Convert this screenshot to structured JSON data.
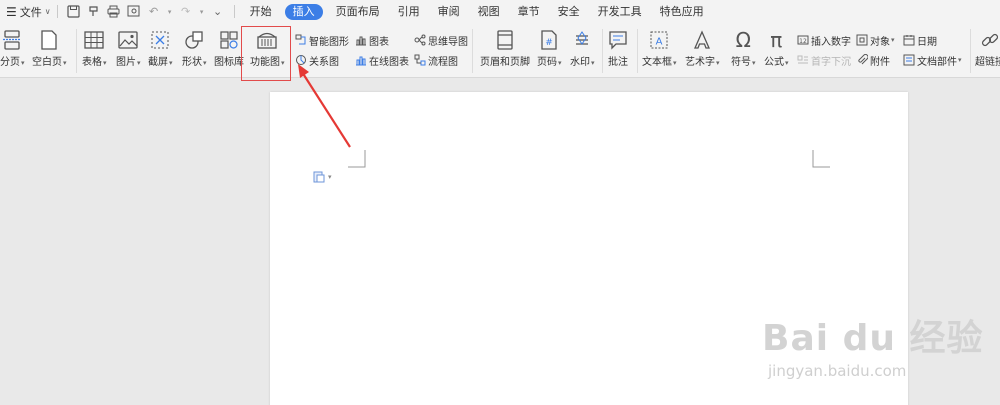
{
  "menubar": {
    "file_label": "文件",
    "tabs": [
      {
        "label": "开始"
      },
      {
        "label": "插入"
      },
      {
        "label": "页面布局"
      },
      {
        "label": "引用"
      },
      {
        "label": "审阅"
      },
      {
        "label": "视图"
      },
      {
        "label": "章节"
      },
      {
        "label": "安全"
      },
      {
        "label": "开发工具"
      },
      {
        "label": "特色应用"
      }
    ],
    "active_tab": "插入",
    "accent_color": "#3c7ee6"
  },
  "ribbon": {
    "page_break": "分页",
    "blank_page": "空白页",
    "table": "表格",
    "picture": "图片",
    "screenshot": "截屏",
    "shapes": "形状",
    "icon_library": "图标库",
    "function_chart": "功能图",
    "smart_art": "智能图形",
    "relation_chart": "关系图",
    "chart": "图表",
    "online_chart": "在线图表",
    "mind_map": "思维导图",
    "flowchart": "流程图",
    "header_footer": "页眉和页脚",
    "page_number": "页码",
    "watermark": "水印",
    "comment": "批注",
    "text_box": "文本框",
    "word_art": "艺术字",
    "symbol": "符号",
    "formula": "公式",
    "insert_number": "插入数字",
    "drop_cap": "首字下沉",
    "object": "对象",
    "attachment": "附件",
    "date": "日期",
    "doc_parts": "文档部件",
    "hyperlink": "超链接"
  },
  "highlight_color": "#e24b4b",
  "watermark": {
    "brand_text": "Bai du 经验",
    "url": "jingyan.baidu.com"
  }
}
